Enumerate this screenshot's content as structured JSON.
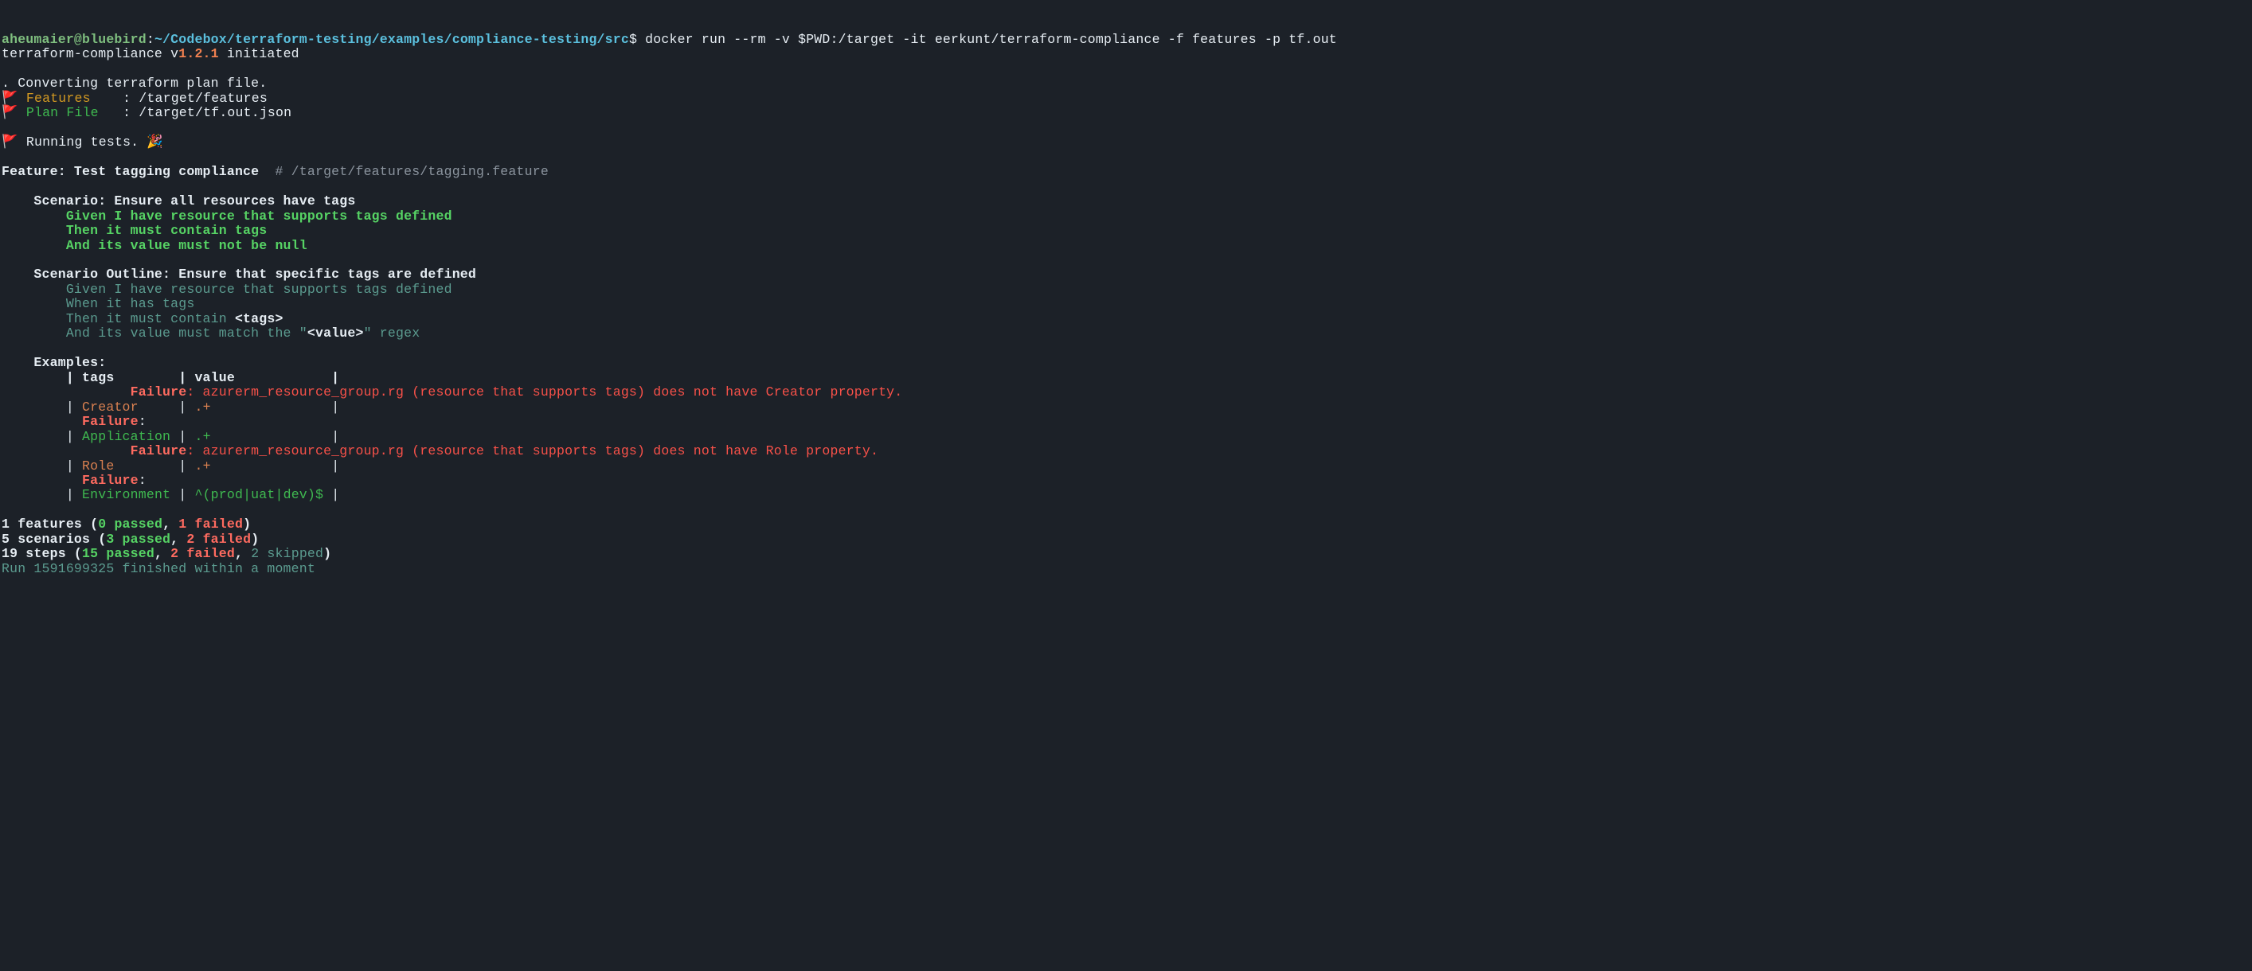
{
  "prompt": {
    "user": "aheumaier@bluebird",
    "colon": ":",
    "path": "~/Codebox/terraform-testing/examples/compliance-testing/src",
    "dollar": "$",
    "command": " docker run --rm -v $PWD:/target -it eerkunt/terraform-compliance -f features -p tf.out"
  },
  "init": {
    "prefix": "terraform-compliance v",
    "version": "1.2.1",
    "suffix": " initiated"
  },
  "converting": ". Converting terraform plan file.",
  "flag": "🚩",
  "features_line": {
    "label": "Features",
    "path": ": /target/features"
  },
  "planfile_line": {
    "label": "Plan File",
    "path": ": /target/tf.out.json"
  },
  "running_tests": "Running tests. ",
  "party": "🎉",
  "feature_header": {
    "title": "Feature: Test tagging compliance ",
    "comment": " # /target/features/tagging.feature"
  },
  "scenario1": {
    "title": "    Scenario: Ensure all resources have tags",
    "given": "        Given I have resource that supports tags defined",
    "then": "        Then it must contain tags",
    "and": "        And its value must not be null"
  },
  "scenario2": {
    "title": "    Scenario Outline: Ensure that specific tags are defined",
    "given": "        Given I have resource that supports tags defined",
    "when": "        When it has tags",
    "then_pre": "        Then it must contain ",
    "then_tag": "<tags>",
    "and_pre": "        And its value must match the \"",
    "and_value": "<value>",
    "and_post": "\" regex"
  },
  "examples": {
    "title": "    Examples:",
    "header": "        | tags        | value            |",
    "fail1_pre": "                Failure",
    "fail1_msg": ": azurerm_resource_group.rg (resource that supports tags) does not have Creator property.",
    "row1_pre": "        | ",
    "row1_tag": "Creator",
    "row1_mid": "     | ",
    "row1_val": ".+",
    "row1_end": "               |",
    "failure_short": "          Failure",
    "failure_colon": ":",
    "row2_tag": "Application",
    "row2_mid": " | ",
    "row2_val": ".+",
    "row2_end": "               |",
    "fail3_msg": ": azurerm_resource_group.rg (resource that supports tags) does not have Role property.",
    "row3_tag": "Role",
    "row3_mid": "        | ",
    "row3_val": ".+",
    "row3_end": "               |",
    "row4_tag": "Environment",
    "row4_mid": " | ",
    "row4_val": "^(prod|uat|dev)$",
    "row4_end": " |"
  },
  "summary": {
    "l1_pre": "1 features (",
    "l1_pass": "0 passed",
    "l1_mid": ", ",
    "l1_fail": "1 failed",
    "l1_end": ")",
    "l2_pre": "5 scenarios (",
    "l2_pass": "3 passed",
    "l2_mid": ", ",
    "l2_fail": "2 failed",
    "l2_end": ")",
    "l3_pre": "19 steps (",
    "l3_pass": "15 passed",
    "l3_mid1": ", ",
    "l3_fail": "2 failed",
    "l3_mid2": ", ",
    "l3_skip": "2 skipped",
    "l3_end": ")",
    "run": "Run 1591699325 finished within a moment"
  }
}
